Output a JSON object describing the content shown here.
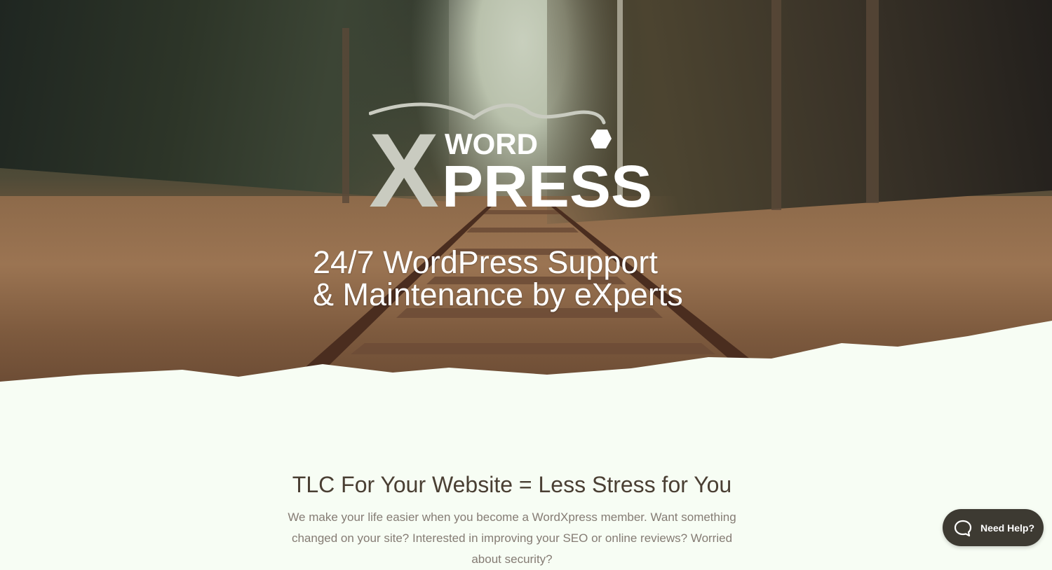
{
  "hero": {
    "logo_word": "WORD",
    "logo_press": "PRESS",
    "logo_x": "X",
    "tagline_line1": "24/7 WordPress Support",
    "tagline_line2": "& Maintenance by eXperts"
  },
  "intro": {
    "heading": "TLC For Your Website = Less Stress for You",
    "paragraph_line1": "We make your life easier when you become a WordXpress member. Want something",
    "paragraph_line2": "changed on your site? Interested in improving your SEO or online reviews? Worried",
    "paragraph_line3": "about security?"
  },
  "help_widget": {
    "label": "Need Help?",
    "icon": "chat-bubble-icon"
  },
  "colors": {
    "background": "#f7fdf4",
    "heading": "#4a3f33",
    "paragraph": "#857c74",
    "help_button": "#3d3a32",
    "logo_gray": "#c9cbc0"
  }
}
